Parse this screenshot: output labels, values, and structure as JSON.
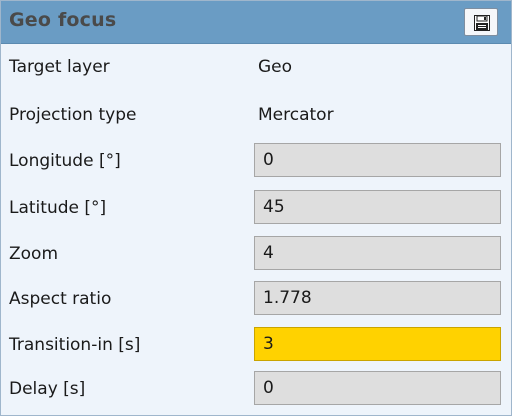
{
  "panel": {
    "title": "Geo focus",
    "save_icon": "floppy-disk-icon"
  },
  "rows": {
    "target_layer": {
      "label": "Target layer",
      "value": "Geo"
    },
    "projection_type": {
      "label": "Projection type",
      "value": "Mercator"
    },
    "longitude": {
      "label": "Longitude [°]",
      "value": "0"
    },
    "latitude": {
      "label": "Latitude [°]",
      "value": "45"
    },
    "zoom": {
      "label": "Zoom",
      "value": "4"
    },
    "aspect_ratio": {
      "label": "Aspect ratio",
      "value": "1.778"
    },
    "transition_in": {
      "label": "Transition-in [s]",
      "value": "3"
    },
    "delay": {
      "label": "Delay [s]",
      "value": "0"
    }
  },
  "colors": {
    "header": "#6a9cc4",
    "panel_background": "#eef4fb",
    "field_background": "#dedede",
    "active_field": "#ffd200"
  }
}
